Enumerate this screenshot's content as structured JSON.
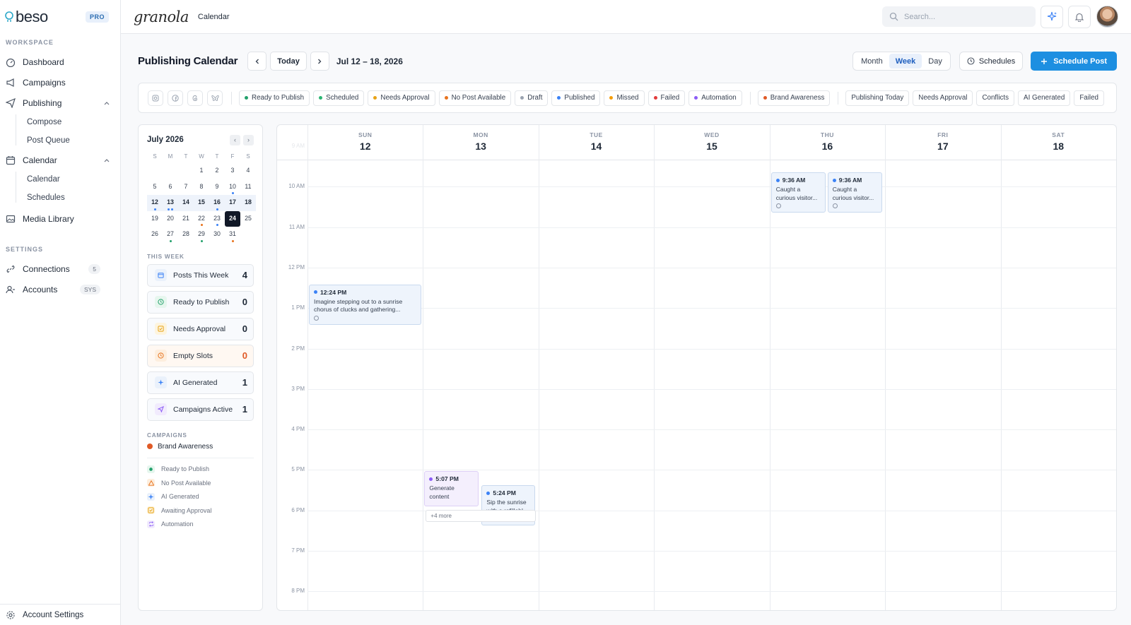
{
  "sidebar": {
    "logo": "beso",
    "badge": "PRO",
    "workspace_label": "WORKSPACE",
    "items": {
      "dashboard": "Dashboard",
      "campaigns": "Campaigns",
      "publishing": "Publishing",
      "compose": "Compose",
      "post_queue": "Post Queue",
      "calendar": "Calendar",
      "calendar_sub": "Calendar",
      "schedules": "Schedules",
      "media_library": "Media Library"
    },
    "settings_label": "SETTINGS",
    "connections": "Connections",
    "connections_count": "5",
    "accounts": "Accounts",
    "accounts_badge": "SYS",
    "account_settings": "Account Settings"
  },
  "topbar": {
    "brand": "granola",
    "crumb": "Calendar",
    "search_placeholder": "Search..."
  },
  "header": {
    "title": "Publishing Calendar",
    "today": "Today",
    "range": "Jul 12 – 18, 2026",
    "views": [
      "Month",
      "Week",
      "Day"
    ],
    "active_view": "Week",
    "schedules": "Schedules",
    "schedule_post": "Schedule Post"
  },
  "filters": {
    "platform_icons": [
      "instagram-icon",
      "facebook-icon",
      "threads-icon",
      "bluesky-icon"
    ],
    "statuses": [
      {
        "label": "Ready to Publish",
        "color": "#22a06b"
      },
      {
        "label": "Scheduled",
        "color": "#2bb673"
      },
      {
        "label": "Needs Approval",
        "color": "#e8a317"
      },
      {
        "label": "No Post Available",
        "color": "#e8731e"
      },
      {
        "label": "Draft",
        "color": "#9aa3b0"
      },
      {
        "label": "Published",
        "color": "#3b82f6"
      },
      {
        "label": "Missed",
        "color": "#f59e0b"
      },
      {
        "label": "Failed",
        "color": "#e23b3b"
      },
      {
        "label": "Automation",
        "color": "#8b5cf6"
      }
    ],
    "campaign": {
      "label": "Brand Awareness",
      "color": "#e05a26"
    },
    "quick": [
      "Publishing Today",
      "Needs Approval",
      "Conflicts",
      "AI Generated",
      "Failed"
    ]
  },
  "mini_calendar": {
    "month": "July 2026",
    "weekdays": [
      "S",
      "M",
      "T",
      "W",
      "T",
      "F",
      "S"
    ],
    "weeks": [
      [
        "",
        "",
        "",
        "1",
        "2",
        "3",
        "4"
      ],
      [
        "5",
        "6",
        "7",
        "8",
        "9",
        "10",
        "11"
      ],
      [
        "12",
        "13",
        "14",
        "15",
        "16",
        "17",
        "18"
      ],
      [
        "19",
        "20",
        "21",
        "22",
        "23",
        "24",
        "25"
      ],
      [
        "26",
        "27",
        "28",
        "29",
        "30",
        "31",
        ""
      ]
    ],
    "selected": "24",
    "current_week": [
      "12",
      "13",
      "14",
      "15",
      "16",
      "17",
      "18"
    ],
    "dots": {
      "10": [
        "#3b82f6"
      ],
      "12": [
        "#3b82f6"
      ],
      "13": [
        "#3b82f6",
        "#3b82f6"
      ],
      "16": [
        "#3b82f6"
      ],
      "22": [
        "#e8731e"
      ],
      "23": [
        "#3b82f6"
      ],
      "27": [
        "#22a06b"
      ],
      "29": [
        "#22a06b"
      ],
      "31": [
        "#e8731e"
      ]
    }
  },
  "this_week": {
    "label": "THIS WEEK",
    "stats": [
      {
        "label": "Posts This Week",
        "value": "4",
        "icon": "calendar-icon",
        "bg": "#eaf1fb",
        "fg": "#3b82f6",
        "valcolor": "#1f2937",
        "rowbg": "#f8fafd"
      },
      {
        "label": "Ready to Publish",
        "value": "0",
        "icon": "clock-icon",
        "bg": "#e6f6ee",
        "fg": "#22a06b",
        "valcolor": "#1f2937",
        "rowbg": "#f8fafd"
      },
      {
        "label": "Needs Approval",
        "value": "0",
        "icon": "check-square-icon",
        "bg": "#fdf4de",
        "fg": "#e8a317",
        "valcolor": "#1f2937",
        "rowbg": "#f8fafd"
      },
      {
        "label": "Empty Slots",
        "value": "0",
        "icon": "clock-icon",
        "bg": "#fdeede",
        "fg": "#e8731e",
        "valcolor": "#e05a26",
        "rowbg": "#fff8f2"
      },
      {
        "label": "AI Generated",
        "value": "1",
        "icon": "sparkle-icon",
        "bg": "#eaf1fb",
        "fg": "#3b82f6",
        "valcolor": "#1f2937",
        "rowbg": "#f8fafd"
      },
      {
        "label": "Campaigns Active",
        "value": "1",
        "icon": "send-icon",
        "bg": "#f1ebfd",
        "fg": "#8b5cf6",
        "valcolor": "#1f2937",
        "rowbg": "#f8fafd"
      }
    ]
  },
  "campaigns": {
    "label": "CAMPAIGNS",
    "items": [
      {
        "name": "Brand Awareness",
        "color": "#e05a26"
      }
    ]
  },
  "legend": [
    {
      "label": "Ready to Publish",
      "icon": "dot-icon",
      "bg": "#e6f6ee",
      "fg": "#22a06b"
    },
    {
      "label": "No Post Available",
      "icon": "warning-icon",
      "bg": "#fdeede",
      "fg": "#e8731e"
    },
    {
      "label": "AI Generated",
      "icon": "sparkle-icon",
      "bg": "#eaf1fb",
      "fg": "#3b82f6"
    },
    {
      "label": "Awaiting Approval",
      "icon": "check-square-icon",
      "bg": "#fdf4de",
      "fg": "#e8a317"
    },
    {
      "label": "Automation",
      "icon": "repeat-icon",
      "bg": "#f1ebfd",
      "fg": "#8b5cf6"
    }
  ],
  "week": {
    "days": [
      {
        "name": "SUN",
        "date": "12"
      },
      {
        "name": "MON",
        "date": "13"
      },
      {
        "name": "TUE",
        "date": "14"
      },
      {
        "name": "WED",
        "date": "15"
      },
      {
        "name": "THU",
        "date": "16"
      },
      {
        "name": "FRI",
        "date": "17"
      },
      {
        "name": "SAT",
        "date": "18"
      }
    ],
    "hours": [
      "9 AM",
      "10 AM",
      "11 AM",
      "12 PM",
      "1 PM",
      "2 PM",
      "3 PM",
      "4 PM",
      "5 PM",
      "6 PM",
      "7 PM",
      "8 PM"
    ],
    "events": [
      {
        "day": 4,
        "time": "9:36 AM",
        "text": "Caught a curious visitor...",
        "dot": "#3b82f6",
        "platform": "facebook-icon"
      },
      {
        "day": 4,
        "time": "9:36 AM",
        "text": "Caught a curious visitor...",
        "dot": "#3b82f6",
        "platform": "instagram-icon"
      },
      {
        "day": 0,
        "time": "12:24 PM",
        "text": "Imagine stepping out to a sunrise chorus of clucks and gathering...",
        "dot": "#3b82f6",
        "platform": "instagram-icon"
      },
      {
        "day": 1,
        "time": "5:07 PM",
        "text": "Generate content",
        "dot": "#8b5cf6",
        "platform": ""
      },
      {
        "day": 1,
        "time": "5:24 PM",
        "text": "Sip the sunrise with a refillabl...",
        "dot": "#3b82f6",
        "platform": "facebook-icon"
      }
    ],
    "more": "+4 more"
  }
}
